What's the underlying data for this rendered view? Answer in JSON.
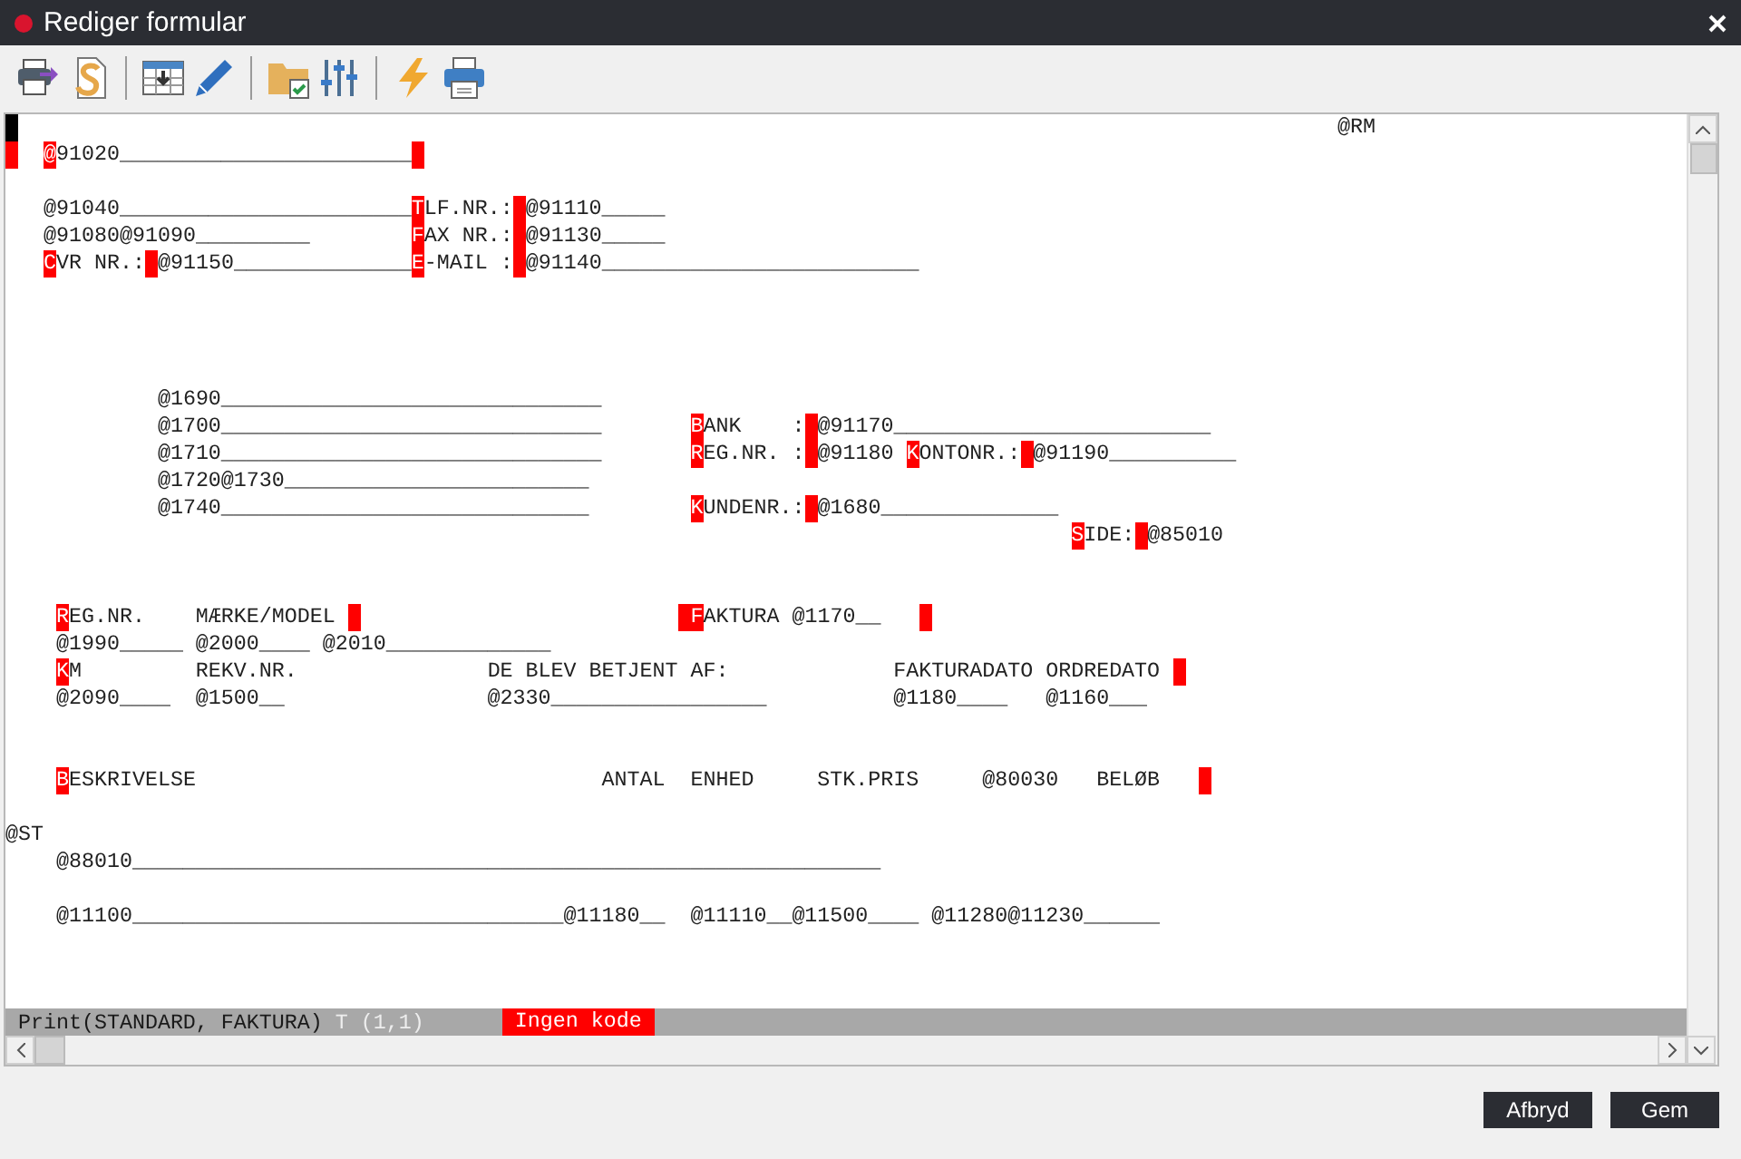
{
  "window": {
    "title": "Rediger formular"
  },
  "editor": {
    "lines": [
      {
        "kind": "text",
        "segments": [
          {
            "kind": "cursor"
          },
          {
            "kind": "text",
            "text": "                                                                                                        @RM"
          }
        ]
      },
      {
        "kind": "text",
        "segments": [
          {
            "kind": "block"
          },
          {
            "kind": "hot",
            "text": "  @"
          },
          {
            "kind": "text",
            "text": "91020_______________________"
          },
          {
            "kind": "block"
          }
        ]
      },
      {
        "kind": "blank"
      },
      {
        "kind": "text",
        "segments": [
          {
            "kind": "text",
            "text": "   @91040_______________________"
          },
          {
            "kind": "hot",
            "text": "T"
          },
          {
            "kind": "text",
            "text": "LF.NR.:"
          },
          {
            "kind": "block"
          },
          {
            "kind": "text",
            "text": "@91110_____"
          }
        ]
      },
      {
        "kind": "text",
        "segments": [
          {
            "kind": "text",
            "text": "   @91080@91090_________        "
          },
          {
            "kind": "hot",
            "text": "F"
          },
          {
            "kind": "text",
            "text": "AX NR.:"
          },
          {
            "kind": "block"
          },
          {
            "kind": "text",
            "text": "@91130_____"
          }
        ]
      },
      {
        "kind": "text",
        "segments": [
          {
            "kind": "hot",
            "text": "   C"
          },
          {
            "kind": "text",
            "text": "VR NR.:"
          },
          {
            "kind": "block"
          },
          {
            "kind": "text",
            "text": "@91150______________"
          },
          {
            "kind": "hot",
            "text": "E"
          },
          {
            "kind": "text",
            "text": "-MAIL :"
          },
          {
            "kind": "block"
          },
          {
            "kind": "text",
            "text": "@91140_________________________"
          }
        ]
      },
      {
        "kind": "blank"
      },
      {
        "kind": "blank"
      },
      {
        "kind": "blank"
      },
      {
        "kind": "blank"
      },
      {
        "kind": "text",
        "segments": [
          {
            "kind": "text",
            "text": "            @1690______________________________"
          }
        ]
      },
      {
        "kind": "text",
        "segments": [
          {
            "kind": "text",
            "text": "            @1700______________________________       "
          },
          {
            "kind": "hot",
            "text": "B"
          },
          {
            "kind": "text",
            "text": "ANK    :"
          },
          {
            "kind": "block"
          },
          {
            "kind": "text",
            "text": "@91170_________________________"
          }
        ]
      },
      {
        "kind": "text",
        "segments": [
          {
            "kind": "text",
            "text": "            @1710______________________________       "
          },
          {
            "kind": "hot",
            "text": "R"
          },
          {
            "kind": "text",
            "text": "EG.NR. :"
          },
          {
            "kind": "block"
          },
          {
            "kind": "text",
            "text": "@91180 "
          },
          {
            "kind": "hot",
            "text": "K"
          },
          {
            "kind": "text",
            "text": "ONTONR.:"
          },
          {
            "kind": "block"
          },
          {
            "kind": "text",
            "text": "@91190__________"
          }
        ]
      },
      {
        "kind": "text",
        "segments": [
          {
            "kind": "text",
            "text": "            @1720@1730________________________"
          }
        ]
      },
      {
        "kind": "text",
        "segments": [
          {
            "kind": "text",
            "text": "            @1740_____________________________        "
          },
          {
            "kind": "hot",
            "text": "K"
          },
          {
            "kind": "text",
            "text": "UNDENR.:"
          },
          {
            "kind": "block"
          },
          {
            "kind": "text",
            "text": "@1680______________"
          }
        ]
      },
      {
        "kind": "text",
        "segments": [
          {
            "kind": "hot",
            "text": "                                                                                    S"
          },
          {
            "kind": "text",
            "text": "IDE:"
          },
          {
            "kind": "block"
          },
          {
            "kind": "text",
            "text": "@85010"
          }
        ]
      },
      {
        "kind": "blank"
      },
      {
        "kind": "blank"
      },
      {
        "kind": "text",
        "segments": [
          {
            "kind": "hot",
            "text": "    R"
          },
          {
            "kind": "text",
            "text": "EG.NR.    MÆRKE/MODEL "
          },
          {
            "kind": "block"
          },
          {
            "kind": "hot",
            "text": "                         F",
            "block_before": true
          },
          {
            "kind": "text",
            "text": "AKTURA @1170__   "
          },
          {
            "kind": "block"
          }
        ]
      },
      {
        "kind": "text",
        "segments": [
          {
            "kind": "text",
            "text": "    @1990_____ @2000____ @2010_____________"
          }
        ]
      },
      {
        "kind": "text",
        "segments": [
          {
            "kind": "hot",
            "text": "    K"
          },
          {
            "kind": "text",
            "text": "M         REKV.NR.               DE BLEV BETJENT AF:             FAKTURADATO ORDREDATO "
          },
          {
            "kind": "block"
          }
        ]
      },
      {
        "kind": "text",
        "segments": [
          {
            "kind": "text",
            "text": "    @2090____  @1500__                @2330_________________          @1180____   @1160___"
          }
        ]
      },
      {
        "kind": "blank"
      },
      {
        "kind": "blank"
      },
      {
        "kind": "text",
        "segments": [
          {
            "kind": "hot",
            "text": "    B"
          },
          {
            "kind": "text",
            "text": "ESKRIVELSE                                ANTAL  ENHED     STK.PRIS     @80030   BELØB   "
          },
          {
            "kind": "block"
          }
        ]
      },
      {
        "kind": "blank"
      },
      {
        "kind": "text",
        "segments": [
          {
            "kind": "text",
            "text": "@ST"
          }
        ]
      },
      {
        "kind": "text",
        "segments": [
          {
            "kind": "text",
            "text": "    @88010___________________________________________________________"
          }
        ]
      },
      {
        "kind": "blank"
      },
      {
        "kind": "text",
        "segments": [
          {
            "kind": "text",
            "text": "    @11100__________________________________@11180__  @11110__@11500____ @11280@11230______"
          }
        ]
      }
    ]
  },
  "status_bar": [
    {
      "kind": "command",
      "text": "Print(STANDARD, FAKTURA)"
    },
    {
      "kind": "position",
      "text": "T (1,1)"
    },
    {
      "kind": "badge",
      "text": "Ingen kode"
    }
  ],
  "buttons": [
    "Afbryd",
    "Gem"
  ]
}
